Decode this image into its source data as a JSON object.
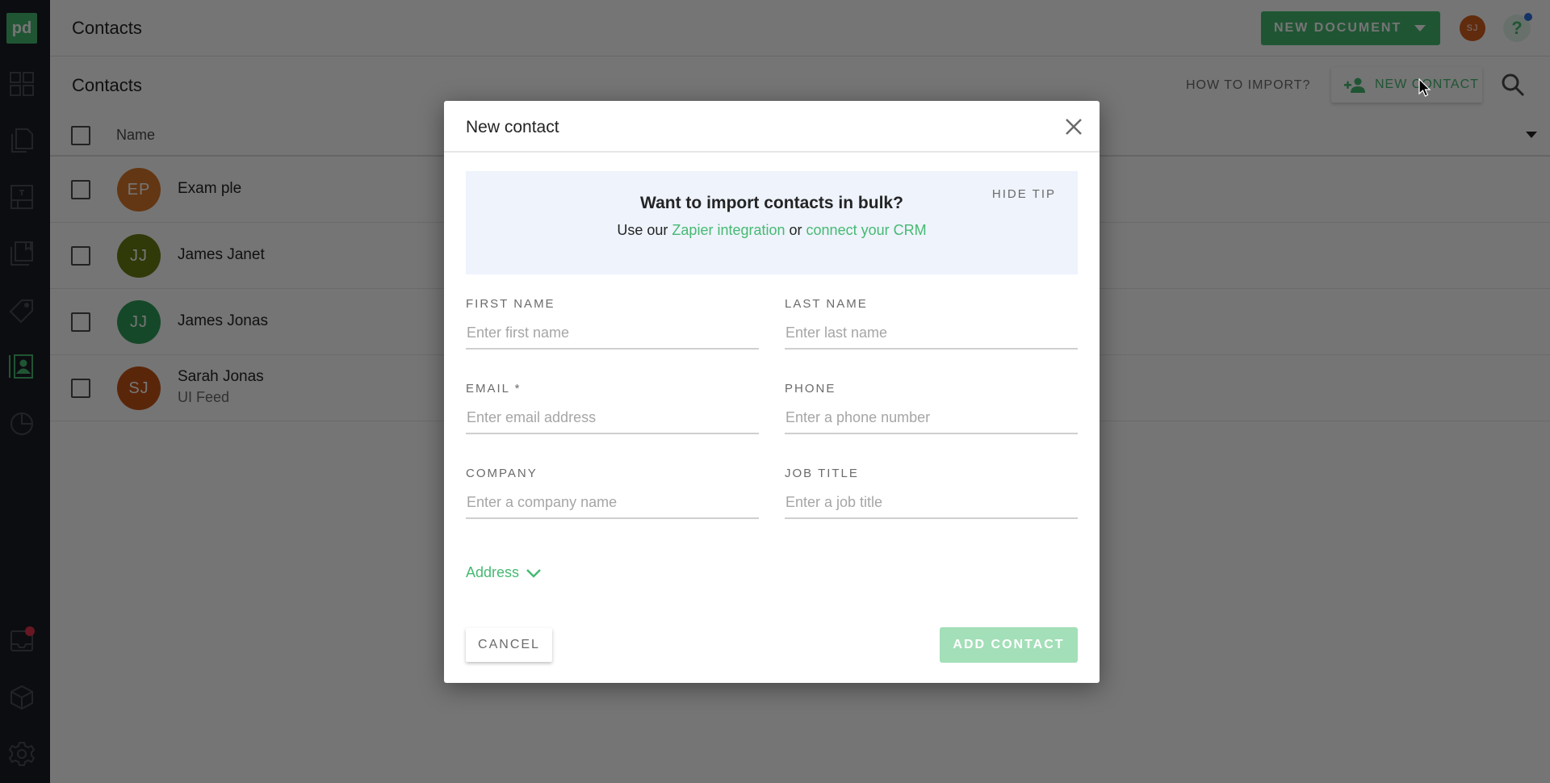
{
  "app": {
    "logo_text": "pd",
    "title": "Contacts"
  },
  "sidebar": {
    "items": [
      {
        "name": "dashboard",
        "icon": "grid-icon"
      },
      {
        "name": "documents",
        "icon": "documents-icon"
      },
      {
        "name": "templates",
        "icon": "template-icon"
      },
      {
        "name": "content-library",
        "icon": "library-icon"
      },
      {
        "name": "catalog",
        "icon": "tag-icon"
      },
      {
        "name": "contacts",
        "icon": "contact-card-icon",
        "active": true
      },
      {
        "name": "reports",
        "icon": "pie-chart-icon"
      },
      {
        "name": "inbox",
        "icon": "inbox-icon",
        "has_notification": true
      },
      {
        "name": "integrations",
        "icon": "cube-icon"
      },
      {
        "name": "settings",
        "icon": "gear-icon"
      }
    ]
  },
  "topbar": {
    "new_document_label": "NEW DOCUMENT",
    "user_initials": "SJ",
    "help_label": "?"
  },
  "subheader": {
    "title": "Contacts",
    "how_to_import_label": "HOW TO IMPORT?",
    "new_contact_label": "NEW CONTACT"
  },
  "table": {
    "columns": [
      "Name"
    ],
    "rows": [
      {
        "initials": "EP",
        "name": "Exam ple",
        "subtitle": "",
        "color": "#d8792a"
      },
      {
        "initials": "JJ",
        "name": "James Janet",
        "subtitle": "",
        "color": "#6a7d12"
      },
      {
        "initials": "JJ",
        "name": "James Jonas",
        "subtitle": "",
        "color": "#2f9e57"
      },
      {
        "initials": "SJ",
        "name": "Sarah Jonas",
        "subtitle": "UI Feed",
        "color": "#c45317"
      }
    ]
  },
  "modal": {
    "title": "New contact",
    "tip": {
      "title": "Want to import contacts in bulk?",
      "text_prefix": "Use our ",
      "link1": "Zapier integration",
      "text_middle": " or ",
      "link2": "connect your CRM",
      "hide_label": "HIDE TIP"
    },
    "fields": {
      "first_name": {
        "label": "FIRST NAME",
        "placeholder": "Enter first name",
        "value": ""
      },
      "last_name": {
        "label": "LAST NAME",
        "placeholder": "Enter last name",
        "value": ""
      },
      "email": {
        "label": "EMAIL *",
        "placeholder": "Enter email address",
        "value": ""
      },
      "phone": {
        "label": "PHONE",
        "placeholder": "Enter a phone number",
        "value": ""
      },
      "company": {
        "label": "COMPANY",
        "placeholder": "Enter a company name",
        "value": ""
      },
      "job_title": {
        "label": "JOB TITLE",
        "placeholder": "Enter a job title",
        "value": ""
      }
    },
    "address_label": "Address",
    "cancel_label": "CANCEL",
    "add_label": "ADD CONTACT"
  },
  "colors": {
    "brand_green": "#47b972",
    "add_button_disabled": "#a3dfb8",
    "tip_background": "#eef3fc"
  }
}
